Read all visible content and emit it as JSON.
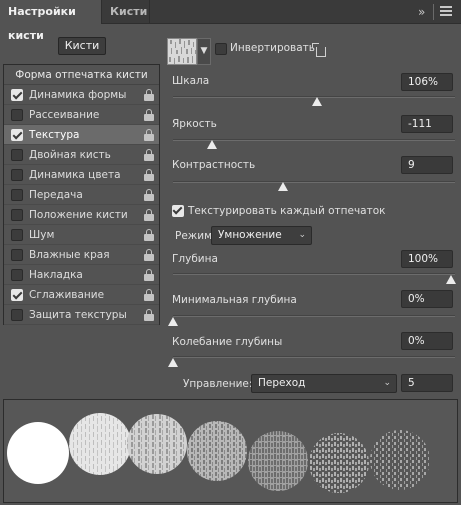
{
  "tabs": {
    "brush_settings": "Настройки кисти",
    "brushes": "Кисти"
  },
  "icons": {
    "expand": "double-chevron-right-icon",
    "menu": "hamburger-menu-icon",
    "lock": "lock-icon",
    "reset": "reset-icon",
    "dropdown": "chevron-down-icon"
  },
  "left": {
    "brushes_button": "Кисти",
    "list_header": "Форма отпечатка кисти",
    "items": [
      {
        "label": "Динамика формы",
        "checked": true
      },
      {
        "label": "Рассеивание",
        "checked": false
      },
      {
        "label": "Текстура",
        "checked": true,
        "selected": true
      },
      {
        "label": "Двойная кисть",
        "checked": false
      },
      {
        "label": "Динамика цвета",
        "checked": false
      },
      {
        "label": "Передача",
        "checked": false
      },
      {
        "label": "Положение кисти",
        "checked": false
      },
      {
        "label": "Шум",
        "checked": false
      },
      {
        "label": "Влажные края",
        "checked": false
      },
      {
        "label": "Накладка",
        "checked": false
      },
      {
        "label": "Сглаживание",
        "checked": true
      },
      {
        "label": "Защита текстуры",
        "checked": false
      }
    ]
  },
  "texture": {
    "invert_label": "Инвертировать",
    "invert_checked": false,
    "scale": {
      "label": "Шкала",
      "value": "106%",
      "slider_fraction": 0.51
    },
    "brightness": {
      "label": "Яркость",
      "value": "-111",
      "slider_fraction": 0.14
    },
    "contrast": {
      "label": "Контрастность",
      "value": "9",
      "slider_fraction": 0.39
    },
    "each_tip_label": "Текстурировать каждый отпечаток",
    "each_tip_checked": true,
    "mode_label": "Режим:",
    "mode_value": "Умножение",
    "depth": {
      "label": "Глубина",
      "value": "100%",
      "slider_fraction": 1.0
    },
    "min_depth": {
      "label": "Минимальная глубина",
      "value": "0%",
      "slider_fraction": 0.0
    },
    "depth_jitter": {
      "label": "Колебание глубины",
      "value": "0%",
      "slider_fraction": 0.0
    },
    "control_label": "Управление:",
    "control_value": "Переход",
    "control_number": "5"
  },
  "colors": {
    "panel_bg": "#535353",
    "tabbar_bg": "#3a3a3a",
    "selected_item": "#6b6b6b",
    "input_bg": "#3a3a3a"
  }
}
